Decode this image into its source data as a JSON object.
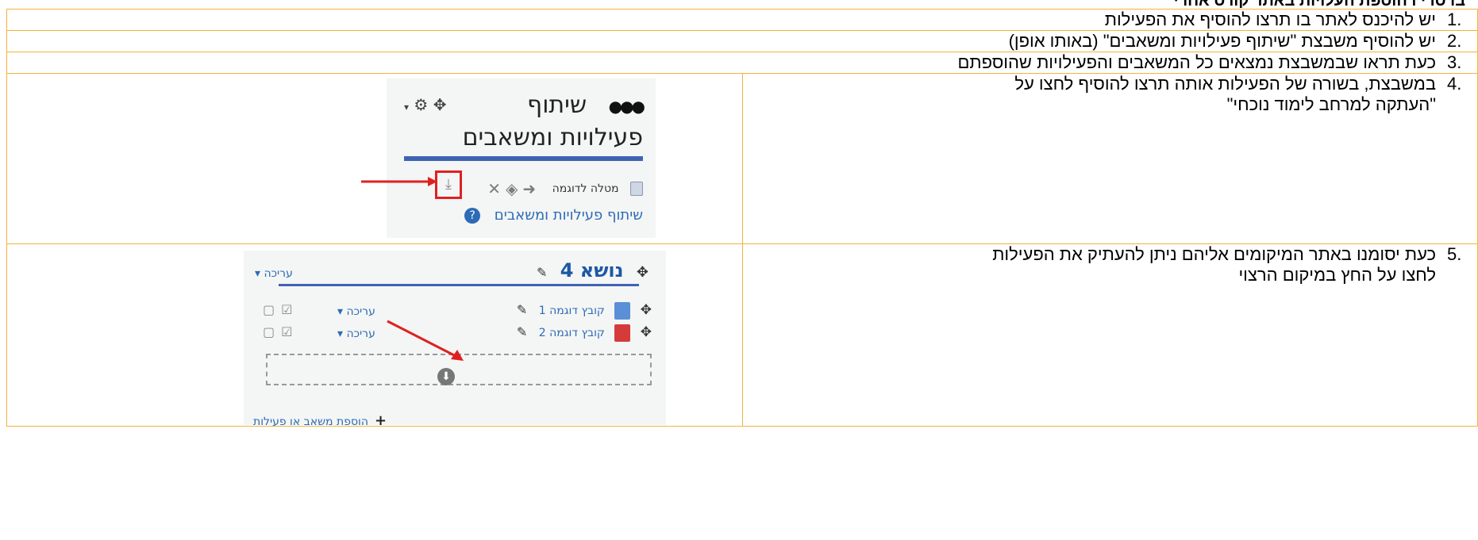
{
  "heading": "בו סו י ו הוספת העלויות באתר קורס אחרי",
  "steps": [
    {
      "num": "1.",
      "text": "יש להיכנס לאתר בו תרצו להוסיף את הפעילות"
    },
    {
      "num": "2.",
      "text": "יש להוסיף משבצת \"שיתוף פעילויות ומשאבים\" (באותו אופן)"
    },
    {
      "num": "3.",
      "text": "כעת תראו שבמשבצת נמצאים כל המשאבים והפעילויות שהוספתם"
    },
    {
      "num": "4.",
      "text_line1": "במשבצת, בשורה של הפעילות אותה תרצו להוסיף לחצו על",
      "text_line2": "\"העתקה למרחב לימוד נוכחי\""
    },
    {
      "num": "5.",
      "text_line1": "כעת יסומנו באתר המיקומים אליהם ניתן להעתיק את הפעילות",
      "text_line2": "לחצו על החץ במיקום הרצוי"
    }
  ],
  "shot1": {
    "title_line1": "שיתוף",
    "title_line2": "פעילויות ומשאבים",
    "activity_name": "מטלה לדוגמה",
    "link_text": "שיתוף פעילויות ומשאבים"
  },
  "shot2": {
    "section_title": "נושא 4",
    "edit_label": "עריכה",
    "items": [
      {
        "name": "קובץ דוגמה 1",
        "edit": "עריכה"
      },
      {
        "name": "קובץ דוגמה 2",
        "edit": "עריכה"
      }
    ],
    "add_label": "הוספת משאב או פעילות"
  },
  "colors": {
    "table_border": "#f0b43c",
    "arrow": "#e02020",
    "link": "#2d6bb5",
    "section_bar": "#3f63b3"
  }
}
